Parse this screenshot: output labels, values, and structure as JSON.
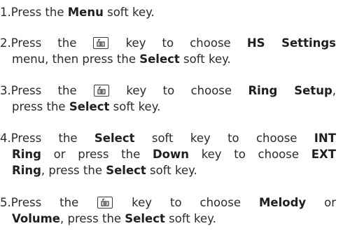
{
  "steps": [
    {
      "num": "1.",
      "parts": [
        "Press the ",
        "Menu",
        " soft key."
      ]
    },
    {
      "num": "2.",
      "l1": [
        "Press the ",
        " key to choose ",
        "HS Settings"
      ],
      "l2": [
        "menu, then press the ",
        "Select",
        " soft key."
      ]
    },
    {
      "num": "3.",
      "l1": [
        "Press the ",
        " key to choose ",
        "Ring Setup",
        ","
      ],
      "l2": [
        "press the ",
        "Select",
        " soft key."
      ]
    },
    {
      "num": "4.",
      "l1": [
        "Press the ",
        "Select",
        " soft key to choose ",
        "INT"
      ],
      "l2": [
        "Ring",
        " or press the ",
        "Down",
        " key to choose ",
        "EXT"
      ],
      "l3": [
        "Ring",
        ", press the ",
        "Select",
        " soft key."
      ]
    },
    {
      "num": "5.",
      "l1": [
        "Press the ",
        " key to choose ",
        "Melody",
        " or"
      ],
      "l2": [
        "Volume",
        ", press the ",
        "Select",
        " soft key."
      ]
    }
  ],
  "icons": {
    "navigation_key": "phonebook-navigation-key-icon"
  }
}
